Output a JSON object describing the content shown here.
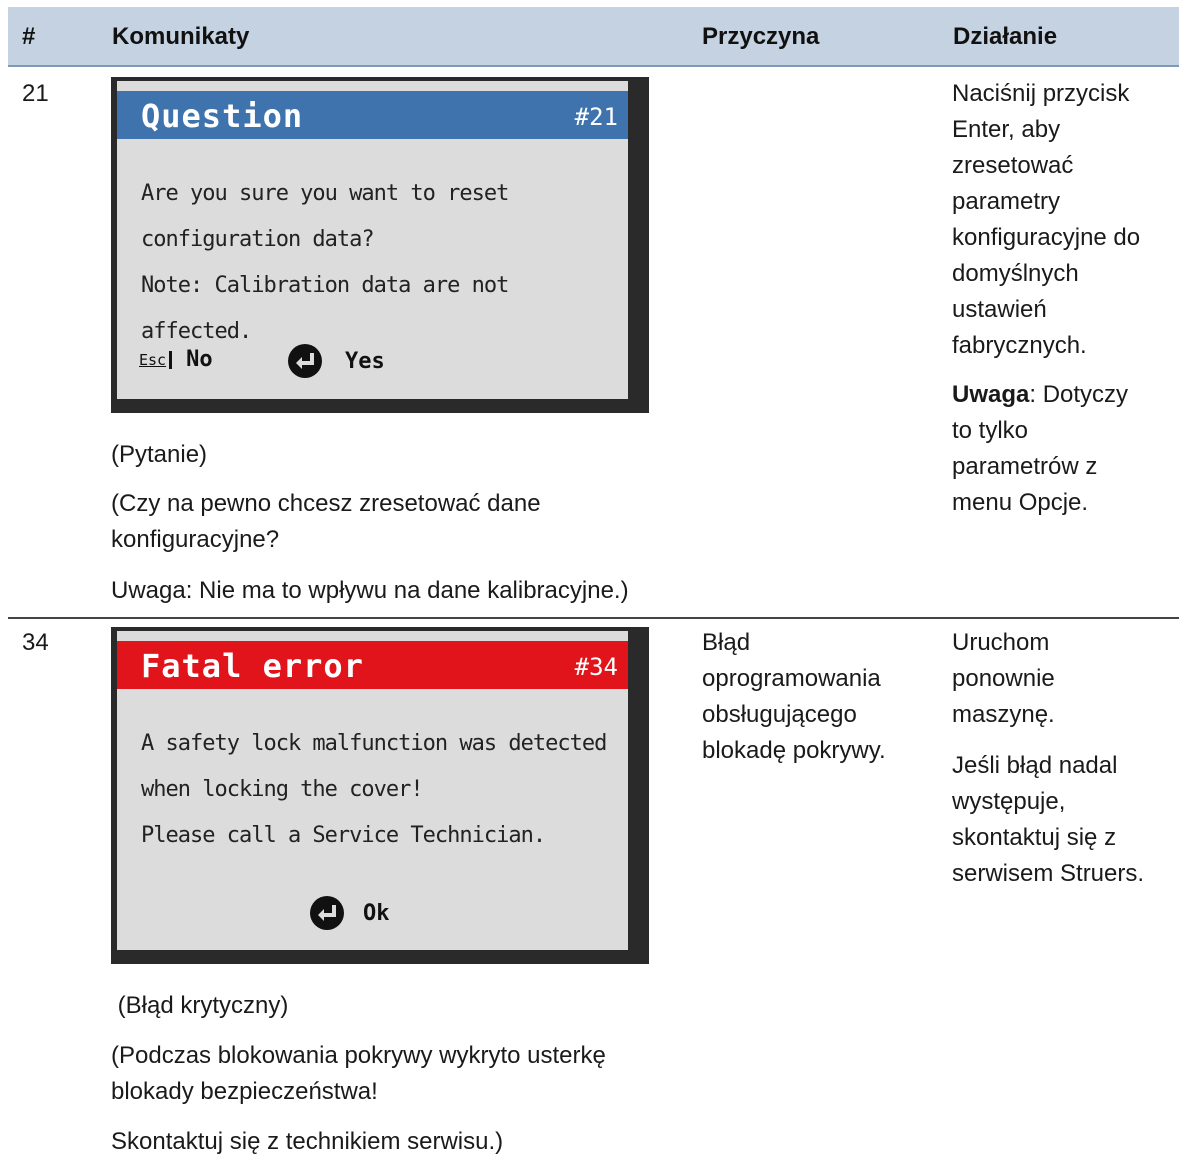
{
  "table": {
    "headers": [
      "#",
      "Komunikaty",
      "Przyczyna",
      "Działanie"
    ],
    "rows": [
      {
        "number": "21",
        "screen": {
          "title": "Question",
          "code": "#21",
          "title_color": "#3e73ad",
          "message": [
            "Are you sure you want to reset",
            "configuration data?",
            "Note: Calibration data are not affected."
          ],
          "esc_label": "Esc",
          "no_label": "No",
          "yes_label": "Yes",
          "icons": [
            "esc-icon",
            "enter-icon"
          ]
        },
        "translation": [
          "(Pytanie)",
          "(Czy na pewno chcesz zresetować dane",
          "konfiguracyjne?",
          "Uwaga: Nie ma to wpływu na dane kalibracyjne.)"
        ],
        "cause": [],
        "action": {
          "lines": [
            "Naciśnij przycisk",
            "Enter, aby",
            "zresetować",
            "parametry",
            "konfiguracyjne do",
            "domyślnych",
            "ustawień",
            "fabrycznych."
          ],
          "note_bold": "Uwaga",
          "note_rest": ": Dotyczy",
          "note_lines": [
            "to tylko",
            "parametrów z",
            "menu Opcje."
          ]
        }
      },
      {
        "number": "34",
        "screen": {
          "title": "Fatal error",
          "code": "#34",
          "title_color": "#e0141a",
          "message": [
            "A safety lock malfunction was detected",
            "when locking the cover!",
            "Please call a Service Technician."
          ],
          "ok_label": "Ok",
          "icons": [
            "enter-icon"
          ]
        },
        "translation": [
          " (Błąd krytyczny)",
          "(Podczas blokowania pokrywy wykryto usterkę",
          "blokady bezpieczeństwa!",
          "Skontaktuj się z technikiem serwisu.)"
        ],
        "cause": [
          "Błąd",
          "oprogramowania",
          "obsługującego",
          "blokadę pokrywy."
        ],
        "action": {
          "lines": [
            "Uruchom",
            "ponownie",
            "maszynę."
          ],
          "lines2": [
            "Jeśli błąd nadal",
            "występuje,",
            "skontaktuj się z",
            "serwisem Struers."
          ]
        }
      }
    ]
  }
}
